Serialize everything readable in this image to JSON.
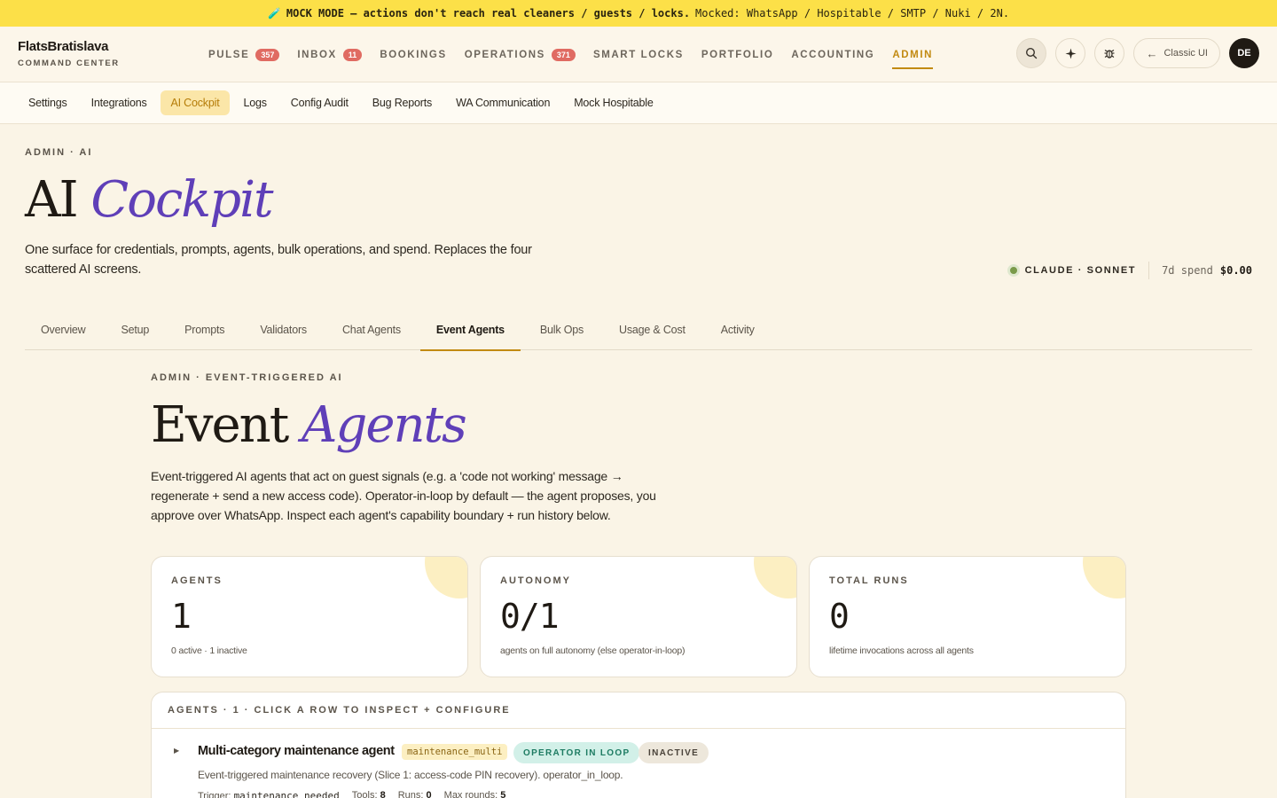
{
  "banner": {
    "emoji": "🧪",
    "bold": "MOCK MODE — actions don't reach real cleaners / guests / locks.",
    "text": "Mocked: WhatsApp / Hospitable / SMTP / Nuki / 2N."
  },
  "brand": {
    "name": "FlatsBratislava",
    "sub": "COMMAND CENTER"
  },
  "nav": {
    "items": [
      {
        "label": "PULSE",
        "badge": "357"
      },
      {
        "label": "INBOX",
        "badge": "11"
      },
      {
        "label": "BOOKINGS"
      },
      {
        "label": "OPERATIONS",
        "badge": "371"
      },
      {
        "label": "SMART LOCKS"
      },
      {
        "label": "PORTFOLIO"
      },
      {
        "label": "ACCOUNTING"
      },
      {
        "label": "ADMIN",
        "active": true
      }
    ],
    "classic_label": "Classic UI",
    "avatar": "DE",
    "icons": [
      "search-icon",
      "sparkle-icon",
      "bug-icon",
      "arrow-left-icon"
    ]
  },
  "subnav": {
    "items": [
      "Settings",
      "Integrations",
      "AI Cockpit",
      "Logs",
      "Config Audit",
      "Bug Reports",
      "WA Communication",
      "Mock Hospitable"
    ],
    "active": "AI Cockpit"
  },
  "header": {
    "eyebrow": "ADMIN · AI",
    "title_plain": "AI",
    "title_accent": "Cockpit",
    "description": "One surface for credentials, prompts, agents, bulk operations, and spend. Replaces the four scattered AI screens.",
    "model": "CLAUDE · SONNET",
    "spend_label": "7d spend",
    "spend_value": "$0.00"
  },
  "tabs": {
    "items": [
      "Overview",
      "Setup",
      "Prompts",
      "Validators",
      "Chat Agents",
      "Event Agents",
      "Bulk Ops",
      "Usage & Cost",
      "Activity"
    ],
    "active": "Event Agents"
  },
  "section": {
    "eyebrow": "ADMIN · EVENT-TRIGGERED AI",
    "title_plain": "Event",
    "title_accent": "Agents",
    "description": "Event-triggered AI agents that act on guest signals (e.g. a 'code not working' message → regenerate + send a new access code). Operator-in-loop by default — the agent proposes, you approve over WhatsApp. Inspect each agent's capability boundary + run history below."
  },
  "stats": [
    {
      "label": "AGENTS",
      "value": "1",
      "sub": "0 active · 1 inactive"
    },
    {
      "label": "AUTONOMY",
      "value": "0/1",
      "sub": "agents on full autonomy (else operator-in-loop)"
    },
    {
      "label": "TOTAL RUNS",
      "value": "0",
      "sub": "lifetime invocations across all agents"
    }
  ],
  "agents": {
    "header": "AGENTS · 1 · CLICK A ROW TO INSPECT + CONFIGURE",
    "rows": [
      {
        "name": "Multi-category maintenance agent",
        "key": "maintenance_multi",
        "mode": "OPERATOR IN LOOP",
        "status": "INACTIVE",
        "description": "Event-triggered maintenance recovery (Slice 1: access-code PIN recovery). operator_in_loop.",
        "trigger_label": "Trigger:",
        "trigger": "maintenance_needed",
        "tools_label": "Tools:",
        "tools": "8",
        "runs_label": "Runs:",
        "runs": "0",
        "max_rounds_label": "Max rounds:",
        "max_rounds": "5"
      }
    ]
  }
}
